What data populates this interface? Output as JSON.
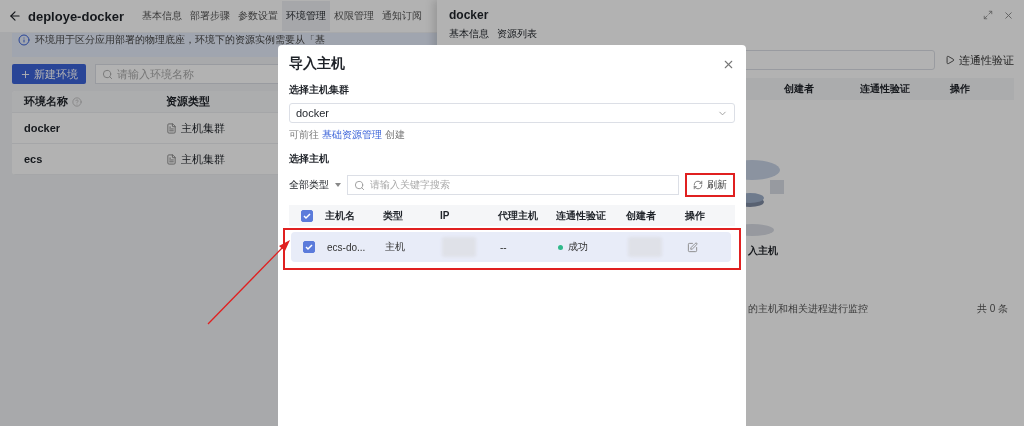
{
  "page": {
    "title": "deploye-docker",
    "tabs": [
      {
        "label": "基本信息",
        "selected": false
      },
      {
        "label": "部署步骤",
        "selected": false
      },
      {
        "label": "参数设置",
        "selected": false
      },
      {
        "label": "环境管理",
        "selected": true
      },
      {
        "label": "权限管理",
        "selected": false
      },
      {
        "label": "通知订阅",
        "selected": false
      }
    ],
    "notice": "环境用于区分应用部署的物理底座，环境下的资源实例需要从「基",
    "new_button": "新建环境",
    "search": {
      "placeholder": "请输入环境名称"
    },
    "table": {
      "columns": [
        "环境名称",
        "资源类型"
      ],
      "rows": [
        {
          "name": "docker",
          "type": "主机集群"
        },
        {
          "name": "ecs",
          "type": "主机集群"
        }
      ]
    }
  },
  "drawer": {
    "title": "docker",
    "tabs": [
      "基本信息",
      "资源列表"
    ],
    "verify_button": "连通性验证",
    "columns": [
      "创建者",
      "连通性验证",
      "操作"
    ],
    "empty_title": "入主机",
    "note": "的主机和相关进程进行监控",
    "total": "共 0 条"
  },
  "dialog": {
    "title": "导入主机",
    "cluster_label": "选择主机集群",
    "cluster_value": "docker",
    "hint": {
      "before": "可前往",
      "link": "基础资源管理",
      "after": "创建"
    },
    "host_label": "选择主机",
    "type_filter": "全部类型",
    "search": {
      "placeholder": "请输入关键字搜索"
    },
    "refresh_button": "刷新",
    "table": {
      "all_checked": true,
      "columns": [
        "主机名",
        "类型",
        "IP",
        "代理主机",
        "连通性验证",
        "创建者",
        "操作"
      ],
      "rows": [
        {
          "checked": true,
          "selected": true,
          "name": "ecs-do...",
          "type": "主机",
          "proxy": "--",
          "status": {
            "kind": "success",
            "label": "成功"
          }
        }
      ]
    }
  }
}
